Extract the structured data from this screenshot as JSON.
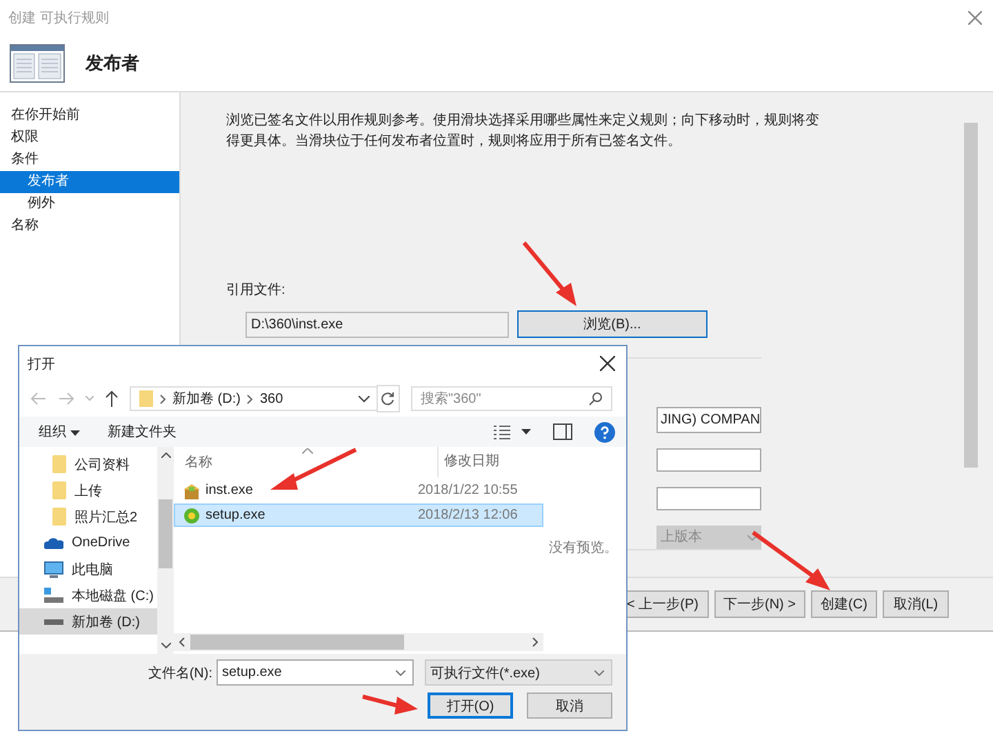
{
  "wizard": {
    "title": "创建 可执行规则",
    "heading": "发布者",
    "nav": [
      {
        "label": "在你开始前",
        "selected": false
      },
      {
        "label": "权限",
        "selected": false
      },
      {
        "label": "条件",
        "selected": false,
        "children": [
          {
            "label": "发布者",
            "selected": true
          },
          {
            "label": "例外",
            "selected": false
          }
        ]
      },
      {
        "label": "名称",
        "selected": false
      }
    ],
    "description": "浏览已签名文件以用作规则参考。使用滑块选择采用哪些属性来定义规则；向下移动时，规则将变得更具体。当滑块位于任何发布者位置时，规则将应用于所有已签名文件。",
    "reference_label": "引用文件:",
    "reference_path": "D:\\360\\inst.exe",
    "browse_button": "浏览(B)...",
    "publisher_fields": [
      {
        "kind": "text",
        "value": "JING) COMPAN"
      },
      {
        "kind": "text"
      },
      {
        "kind": "text"
      },
      {
        "kind": "dropdown",
        "value": "上版本",
        "disabled": true
      }
    ],
    "buttons": [
      "< 上一步(P)",
      "下一步(N) >",
      "创建(C)",
      "取消(L)"
    ]
  },
  "open_dialog": {
    "title": "打开",
    "breadcrumb": [
      "新加卷 (D:)",
      "360"
    ],
    "search_placeholder": "搜索\"360\"",
    "toolbar": [
      {
        "label": "组织",
        "kind": "menu"
      },
      {
        "label": "新建文件夹",
        "kind": "plain"
      }
    ],
    "nav_tree": [
      {
        "label": "公司资料",
        "kind": "folder",
        "selected": false
      },
      {
        "label": "上传",
        "kind": "folder",
        "selected": false
      },
      {
        "label": "照片汇总2",
        "kind": "folder",
        "selected": false
      },
      {
        "label": "OneDrive",
        "kind": "cloud",
        "selected": false
      },
      {
        "label": "此电脑",
        "kind": "computer",
        "selected": false
      },
      {
        "label": "本地磁盘 (C:)",
        "kind": "system-drive",
        "selected": false
      },
      {
        "label": "新加卷 (D:)",
        "kind": "drive",
        "selected": true
      }
    ],
    "columns": [
      "名称",
      "修改日期"
    ],
    "files": [
      {
        "name": "inst.exe",
        "date": "2018/1/22 10:55",
        "kind": "package",
        "selected": false
      },
      {
        "name": "setup.exe",
        "date": "2018/2/13 12:06",
        "kind": "installer",
        "selected": true
      }
    ],
    "preview_text": "没有预览。",
    "filename_label": "文件名(N):",
    "filename": "setup.exe",
    "filter": "可执行文件(*.exe)",
    "buttons": [
      {
        "label": "打开(O)",
        "default": true
      },
      {
        "label": "取消",
        "default": false
      }
    ]
  }
}
